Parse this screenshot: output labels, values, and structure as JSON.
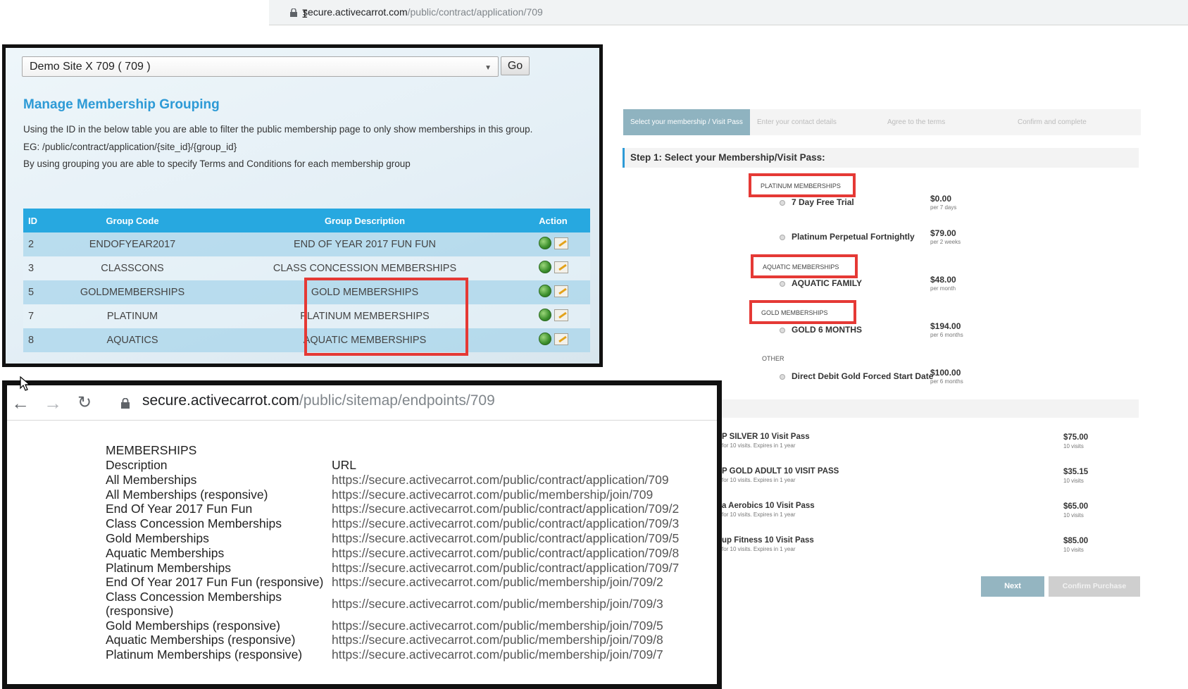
{
  "top_browser": {
    "url_host": "secure.activecarrot.com",
    "url_path": "/public/contract/application/709"
  },
  "admin": {
    "site_select_value": "Demo Site X 709 ( 709 )",
    "go_label": "Go",
    "title": "Manage Membership Grouping",
    "info_line_1": "Using the ID in the below table you are able to filter the public membership page to only show memberships in this group.",
    "info_line_2": "EG: /public/contract/application/{site_id}/{group_id}",
    "info_line_3": "By using grouping you are able to specify Terms and Conditions for each membership group",
    "table": {
      "headers": [
        "ID",
        "Group Code",
        "Group Description",
        "Action"
      ],
      "rows": [
        {
          "id": "2",
          "code": "ENDOFYEAR2017",
          "description": "END OF YEAR 2017 FUN FUN"
        },
        {
          "id": "3",
          "code": "CLASSCONS",
          "description": "CLASS CONCESSION MEMBERSHIPS"
        },
        {
          "id": "5",
          "code": "GOLDMEMBERSHIPS",
          "description": "GOLD MEMBERSHIPS"
        },
        {
          "id": "7",
          "code": "PLATINUM",
          "description": "PLATINUM MEMBERSHIPS"
        },
        {
          "id": "8",
          "code": "AQUATICS",
          "description": "AQUATIC MEMBERSHIPS"
        }
      ]
    }
  },
  "sitemap": {
    "url_host": "secure.activecarrot.com",
    "url_path": "/public/sitemap/endpoints/709",
    "section_title": "MEMBERSHIPS",
    "col_description": "Description",
    "col_url": "URL",
    "rows": [
      {
        "desc": "All Memberships",
        "url": "https://secure.activecarrot.com/public/contract/application/709"
      },
      {
        "desc": "All Memberships (responsive)",
        "url": "https://secure.activecarrot.com/public/membership/join/709"
      },
      {
        "desc": "End Of Year 2017 Fun Fun",
        "url": "https://secure.activecarrot.com/public/contract/application/709/2"
      },
      {
        "desc": "Class Concession Memberships",
        "url": "https://secure.activecarrot.com/public/contract/application/709/3"
      },
      {
        "desc": "Gold Memberships",
        "url": "https://secure.activecarrot.com/public/contract/application/709/5"
      },
      {
        "desc": "Aquatic Memberships",
        "url": "https://secure.activecarrot.com/public/contract/application/709/8"
      },
      {
        "desc": "Platinum Memberships",
        "url": "https://secure.activecarrot.com/public/contract/application/709/7"
      },
      {
        "desc": "End Of Year 2017 Fun Fun (responsive)",
        "url": "https://secure.activecarrot.com/public/membership/join/709/2"
      },
      {
        "desc": "Class Concession Memberships",
        "desc2": "(responsive)",
        "url": "https://secure.activecarrot.com/public/membership/join/709/3"
      },
      {
        "desc": "Gold Memberships (responsive)",
        "url": "https://secure.activecarrot.com/public/membership/join/709/5"
      },
      {
        "desc": "Aquatic Memberships (responsive)",
        "url": "https://secure.activecarrot.com/public/membership/join/709/8"
      },
      {
        "desc": "Platinum Memberships (responsive)",
        "url": "https://secure.activecarrot.com/public/membership/join/709/7"
      }
    ]
  },
  "public": {
    "steps": [
      "Select your membership / Visit Pass",
      "Enter your contact details",
      "Agree to the terms",
      "Confirm and complete"
    ],
    "step_heading": "Step 1: Select your Membership/Visit Pass:",
    "groups": {
      "platinum": "PLATINUM MEMBERSHIPS",
      "aquatic": "AQUATIC MEMBERSHIPS",
      "gold": "GOLD MEMBERSHIPS",
      "other": "OTHER"
    },
    "options": [
      {
        "name": "7 Day Free Trial",
        "price": "$0.00",
        "period": "per 7 days"
      },
      {
        "name": "Platinum Perpetual Fortnightly",
        "price": "$79.00",
        "period": "per 2 weeks"
      },
      {
        "name": "AQUATIC FAMILY",
        "price": "$48.00",
        "period": "per month"
      },
      {
        "name": "GOLD 6 MONTHS",
        "price": "$194.00",
        "period": "per 6 months"
      },
      {
        "name": "Direct Debit Gold Forced Start Date",
        "price": "$100.00",
        "period": "per 6 months"
      }
    ],
    "visit_passes": [
      {
        "name": "P SILVER 10 Visit Pass",
        "detail": "for 10 visits. Expires in 1 year",
        "price": "$75.00",
        "visits": "10 visits"
      },
      {
        "name": "P GOLD ADULT 10 VISIT PASS",
        "detail": "for 10 visits. Expires in 1 year",
        "price": "$35.15",
        "visits": "10 visits"
      },
      {
        "name": "a Aerobics 10 Visit Pass",
        "detail": "for 10 visits. Expires in 1 year",
        "price": "$65.00",
        "visits": "10 visits"
      },
      {
        "name": "up Fitness 10 Visit Pass",
        "detail": "for 10 visits. Expires in 1 year",
        "price": "$85.00",
        "visits": "10 visits"
      }
    ],
    "next_label": "Next",
    "confirm_label": "Confirm Purchase"
  }
}
